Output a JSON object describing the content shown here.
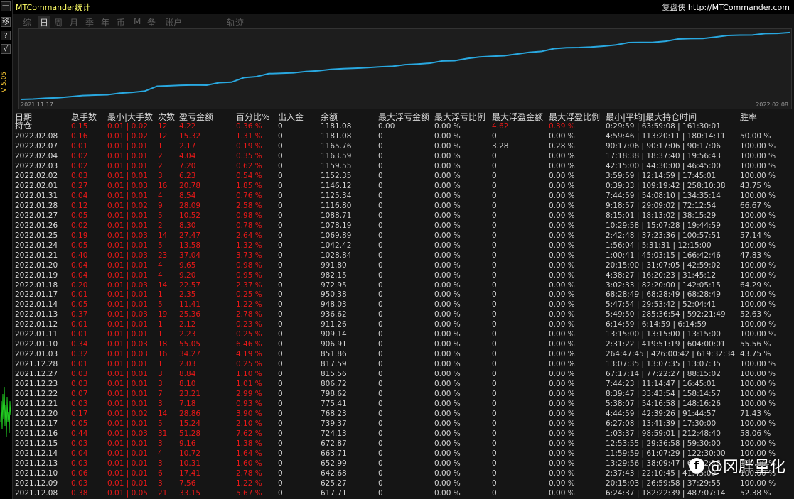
{
  "app": {
    "title": "MTCommander统计",
    "brand": "复盘侠",
    "url": "http://MTCommander.com",
    "version": "V 5.05"
  },
  "side_buttons": [
    "一",
    "移",
    "?",
    "√"
  ],
  "tabs": [
    {
      "label": "综",
      "active": false
    },
    {
      "label": "日",
      "active": true
    },
    {
      "label": "周",
      "active": false
    },
    {
      "label": "月",
      "active": false
    },
    {
      "label": "季",
      "active": false
    },
    {
      "label": "年",
      "active": false
    },
    {
      "label": "币",
      "active": false
    },
    {
      "label": "M",
      "active": false
    },
    {
      "label": "备",
      "active": false
    },
    {
      "label": "账户",
      "active": false
    },
    {
      "label": "轨迹",
      "active": false
    }
  ],
  "chart_data": {
    "type": "line",
    "x_start_label": "2021.11.17",
    "x_end_label": "2022.02.08",
    "line_color": "#29a8e0",
    "values": [
      1132.84,
      1139.79,
      1153.32,
      1161.76,
      1181.47,
      1201.99,
      1210.05,
      1216.07,
      1244.89,
      1260.2,
      1281.04,
      1370.11,
      1377.46,
      1387.46,
      1392.23,
      1388.44,
      1433.4,
      1443.4,
      1525.37,
      1543.37,
      1596.44,
      1604.84,
      1612.31,
      1636.6,
      1648.62,
      1673.52,
      1686.63,
      1694.71,
      1704.92,
      1720.33,
      1729.68,
      1758.99,
      1771.23,
      1785.93,
      1825.5,
      1830.7,
      1870.2,
      1898.52,
      1911.39,
      1920.75,
      1951.89,
      1982.35,
      1999.31,
      2048.62,
      2065.2,
      2068.03,
      2077.97,
      2093.29,
      2117.19,
      2158.12,
      2162.06,
      2163.04,
      2182.6,
      2221.77,
      2229.85,
      2231.53,
      2257.58,
      2285.55,
      2292.58,
      2293.19,
      2319.71,
      2322.97,
      2337.93
    ],
    "ylim": [
      1120,
      2350
    ]
  },
  "table": {
    "headers": [
      "日期",
      "总手数",
      "最小|大手数",
      "次数",
      "盈亏金额",
      "百分比%",
      "出入金",
      "余额",
      "最大浮亏金额",
      "最大浮亏比例",
      "最大浮盈金额",
      "最大浮盈比例",
      "最小|平均|最大持仓时间",
      "胜率"
    ],
    "rows": [
      [
        "持仓",
        "0.15",
        "0.01 | 0.02",
        "12",
        "4.22",
        "0.36 %",
        "0",
        "1181.08",
        "0.00",
        "0.00 %",
        "4.62",
        "0.39 %",
        "0:29:59 | 63:59:08 | 161:30:01",
        ""
      ],
      [
        "2022.02.08",
        "0.16",
        "0.01 | 0.02",
        "12",
        "15.32",
        "1.31 %",
        "0",
        "1181.08",
        "0",
        "0.00 %",
        "0",
        "0.00 %",
        "4:59:46 | 113:20:11 | 180:14:11",
        "50.00 %"
      ],
      [
        "2022.02.07",
        "0.01",
        "0.01 | 0.01",
        "1",
        "2.17",
        "0.19 %",
        "0",
        "1165.76",
        "0",
        "0.00 %",
        "3.28",
        "0.28 %",
        "90:17:06 | 90:17:06 | 90:17:06",
        "100.00 %"
      ],
      [
        "2022.02.04",
        "0.02",
        "0.01 | 0.01",
        "2",
        "4.04",
        "0.35 %",
        "0",
        "1163.59",
        "0",
        "0.00 %",
        "0",
        "0.00 %",
        "17:18:38 | 18:37:40 | 19:56:43",
        "100.00 %"
      ],
      [
        "2022.02.03",
        "0.02",
        "0.01 | 0.01",
        "2",
        "7.20",
        "0.62 %",
        "0",
        "1159.55",
        "0",
        "0.00 %",
        "0",
        "0.00 %",
        "42:15:00 | 44:30:00 | 46:45:00",
        "100.00 %"
      ],
      [
        "2022.02.02",
        "0.03",
        "0.01 | 0.01",
        "3",
        "6.23",
        "0.54 %",
        "0",
        "1152.35",
        "0",
        "0.00 %",
        "0",
        "0.00 %",
        "3:59:59 | 12:14:59 | 17:45:01",
        "100.00 %"
      ],
      [
        "2022.02.01",
        "0.27",
        "0.01 | 0.03",
        "16",
        "20.78",
        "1.85 %",
        "0",
        "1146.12",
        "0",
        "0.00 %",
        "0",
        "0.00 %",
        "0:39:33 | 109:19:42 | 258:10:38",
        "43.75 %"
      ],
      [
        "2022.01.31",
        "0.04",
        "0.01 | 0.01",
        "4",
        "8.54",
        "0.76 %",
        "0",
        "1125.34",
        "0",
        "0.00 %",
        "0",
        "0.00 %",
        "7:44:59 | 54:08:10 | 134:35:14",
        "100.00 %"
      ],
      [
        "2022.01.28",
        "0.12",
        "0.01 | 0.02",
        "9",
        "28.09",
        "2.58 %",
        "0",
        "1116.80",
        "0",
        "0.00 %",
        "0",
        "0.00 %",
        "9:18:57 | 29:09:02 | 72:12:54",
        "66.67 %"
      ],
      [
        "2022.01.27",
        "0.05",
        "0.01 | 0.01",
        "5",
        "10.52",
        "0.98 %",
        "0",
        "1088.71",
        "0",
        "0.00 %",
        "0",
        "0.00 %",
        "8:15:01 | 18:13:02 | 38:15:29",
        "100.00 %"
      ],
      [
        "2022.01.26",
        "0.02",
        "0.01 | 0.01",
        "2",
        "8.30",
        "0.78 %",
        "0",
        "1078.19",
        "0",
        "0.00 %",
        "0",
        "0.00 %",
        "10:29:58 | 15:07:28 | 19:44:59",
        "100.00 %"
      ],
      [
        "2022.01.25",
        "0.19",
        "0.01 | 0.03",
        "14",
        "27.47",
        "2.64 %",
        "0",
        "1069.89",
        "0",
        "0.00 %",
        "0",
        "0.00 %",
        "2:42:48 | 37:23:36 | 100:57:51",
        "57.14 %"
      ],
      [
        "2022.01.24",
        "0.05",
        "0.01 | 0.01",
        "5",
        "13.58",
        "1.32 %",
        "0",
        "1042.42",
        "0",
        "0.00 %",
        "0",
        "0.00 %",
        "1:56:04 | 5:31:31 | 12:15:00",
        "100.00 %"
      ],
      [
        "2022.01.21",
        "0.40",
        "0.01 | 0.03",
        "23",
        "37.04",
        "3.73 %",
        "0",
        "1028.84",
        "0",
        "0.00 %",
        "0",
        "0.00 %",
        "1:00:41 | 45:03:15 | 166:42:46",
        "47.83 %"
      ],
      [
        "2022.01.20",
        "0.04",
        "0.01 | 0.01",
        "4",
        "9.65",
        "0.98 %",
        "0",
        "991.80",
        "0",
        "0.00 %",
        "0",
        "0.00 %",
        "20:15:00 | 31:07:05 | 42:59:02",
        "100.00 %"
      ],
      [
        "2022.01.19",
        "0.04",
        "0.01 | 0.01",
        "4",
        "9.20",
        "0.95 %",
        "0",
        "982.15",
        "0",
        "0.00 %",
        "0",
        "0.00 %",
        "4:38:27 | 16:20:23 | 31:45:12",
        "100.00 %"
      ],
      [
        "2022.01.18",
        "0.20",
        "0.01 | 0.03",
        "14",
        "22.57",
        "2.37 %",
        "0",
        "972.95",
        "0",
        "0.00 %",
        "0",
        "0.00 %",
        "3:02:33 | 82:20:00 | 142:05:15",
        "64.29 %"
      ],
      [
        "2022.01.17",
        "0.01",
        "0.01 | 0.01",
        "1",
        "2.35",
        "0.25 %",
        "0",
        "950.38",
        "0",
        "0.00 %",
        "0",
        "0.00 %",
        "68:28:49 | 68:28:49 | 68:28:49",
        "100.00 %"
      ],
      [
        "2022.01.14",
        "0.05",
        "0.01 | 0.01",
        "5",
        "11.41",
        "1.22 %",
        "0",
        "948.03",
        "0",
        "0.00 %",
        "0",
        "0.00 %",
        "5:47:54 | 29:53:42 | 52:04:41",
        "100.00 %"
      ],
      [
        "2022.01.13",
        "0.37",
        "0.01 | 0.03",
        "19",
        "25.36",
        "2.78 %",
        "0",
        "936.62",
        "0",
        "0.00 %",
        "0",
        "0.00 %",
        "5:49:50 | 285:36:54 | 592:21:49",
        "52.63 %"
      ],
      [
        "2022.01.12",
        "0.01",
        "0.01 | 0.01",
        "1",
        "2.12",
        "0.23 %",
        "0",
        "911.26",
        "0",
        "0.00 %",
        "0",
        "0.00 %",
        "6:14:59 | 6:14:59 | 6:14:59",
        "100.00 %"
      ],
      [
        "2022.01.11",
        "0.01",
        "0.01 | 0.01",
        "1",
        "2.23",
        "0.25 %",
        "0",
        "909.14",
        "0",
        "0.00 %",
        "0",
        "0.00 %",
        "13:15:00 | 13:15:00 | 13:15:00",
        "100.00 %"
      ],
      [
        "2022.01.10",
        "0.34",
        "0.01 | 0.03",
        "18",
        "55.05",
        "6.46 %",
        "0",
        "906.91",
        "0",
        "0.00 %",
        "0",
        "0.00 %",
        "2:31:22 | 419:51:19 | 604:00:01",
        "55.56 %"
      ],
      [
        "2022.01.03",
        "0.32",
        "0.01 | 0.03",
        "16",
        "34.27",
        "4.19 %",
        "0",
        "851.86",
        "0",
        "0.00 %",
        "0",
        "0.00 %",
        "264:47:45 | 426:00:42 | 619:32:34",
        "43.75 %"
      ],
      [
        "2021.12.28",
        "0.01",
        "0.01 | 0.01",
        "1",
        "2.03",
        "0.25 %",
        "0",
        "817.59",
        "0",
        "0.00 %",
        "0",
        "0.00 %",
        "13:07:35 | 13:07:35 | 13:07:35",
        "100.00 %"
      ],
      [
        "2021.12.27",
        "0.03",
        "0.01 | 0.01",
        "3",
        "8.84",
        "1.10 %",
        "0",
        "815.56",
        "0",
        "0.00 %",
        "0",
        "0.00 %",
        "67:17:14 | 77:22:27 | 88:15:02",
        "100.00 %"
      ],
      [
        "2021.12.23",
        "0.03",
        "0.01 | 0.01",
        "3",
        "8.10",
        "1.01 %",
        "0",
        "806.72",
        "0",
        "0.00 %",
        "0",
        "0.00 %",
        "7:44:23 | 11:14:47 | 16:45:01",
        "100.00 %"
      ],
      [
        "2021.12.22",
        "0.07",
        "0.01 | 0.01",
        "7",
        "23.21",
        "2.99 %",
        "0",
        "798.62",
        "0",
        "0.00 %",
        "0",
        "0.00 %",
        "8:39:47 | 33:43:54 | 158:14:57",
        "100.00 %"
      ],
      [
        "2021.12.21",
        "0.03",
        "0.01 | 0.01",
        "3",
        "7.18",
        "0.93 %",
        "0",
        "775.41",
        "0",
        "0.00 %",
        "0",
        "0.00 %",
        "5:38:07 | 54:16:58 | 148:16:26",
        "100.00 %"
      ],
      [
        "2021.12.20",
        "0.17",
        "0.01 | 0.02",
        "14",
        "28.86",
        "3.90 %",
        "0",
        "768.23",
        "0",
        "0.00 %",
        "0",
        "0.00 %",
        "4:44:59 | 42:39:26 | 91:44:57",
        "71.43 %"
      ],
      [
        "2021.12.17",
        "0.05",
        "0.01 | 0.01",
        "5",
        "15.24",
        "2.10 %",
        "0",
        "739.37",
        "0",
        "0.00 %",
        "0",
        "0.00 %",
        "6:27:08 | 13:41:39 | 17:30:00",
        "100.00 %"
      ],
      [
        "2021.12.16",
        "0.44",
        "0.01 | 0.03",
        "31",
        "51.28",
        "7.62 %",
        "0",
        "724.13",
        "0",
        "0.00 %",
        "0",
        "0.00 %",
        "1:03:37 | 98:59:01 | 212:48:40",
        "58.06 %"
      ],
      [
        "2021.12.15",
        "0.03",
        "0.01 | 0.01",
        "3",
        "9.16",
        "1.38 %",
        "0",
        "672.87",
        "0",
        "0.00 %",
        "0",
        "0.00 %",
        "12:53:55 | 29:36:58 | 59:30:00",
        "100.00 %"
      ],
      [
        "2021.12.14",
        "0.04",
        "0.01 | 0.01",
        "4",
        "10.72",
        "1.64 %",
        "0",
        "663.71",
        "0",
        "0.00 %",
        "0",
        "0.00 %",
        "11:59:59 | 61:07:29 | 122:30:00",
        "100.00 %"
      ],
      [
        "2021.12.13",
        "0.03",
        "0.01 | 0.01",
        "3",
        "10.31",
        "1.60 %",
        "0",
        "652.99",
        "0",
        "0.00 %",
        "0",
        "0.00 %",
        "13:29:56 | 38:09:47 | 61:52:28",
        "100.00 %"
      ],
      [
        "2021.12.10",
        "0.06",
        "0.01 | 0.01",
        "6",
        "17.41",
        "2.78 %",
        "0",
        "642.68",
        "0",
        "0.00 %",
        "0",
        "0.00 %",
        "2:37:43 | 22:10:45 | 41:45:00",
        "100.00 %"
      ],
      [
        "2021.12.09",
        "0.03",
        "0.01 | 0.01",
        "3",
        "7.56",
        "1.22 %",
        "0",
        "625.27",
        "0",
        "0.00 %",
        "0",
        "0.00 %",
        "20:15:03 | 26:59:58 | 37:29:55",
        "100.00 %"
      ],
      [
        "2021.12.08",
        "0.38",
        "0.01 | 0.05",
        "21",
        "33.15",
        "5.67 %",
        "0",
        "617.71",
        "0",
        "0.00 %",
        "0",
        "0.00 %",
        "6:24:37 | 182:22:39 | 487:07:14",
        "52.38 %"
      ]
    ],
    "first_row_red_cols": [
      1,
      2,
      3,
      4,
      5,
      10,
      11
    ],
    "red_cols": [
      1,
      2,
      3,
      4,
      5
    ]
  },
  "watermark": {
    "icon": "f",
    "text": "@冈胖量化"
  }
}
